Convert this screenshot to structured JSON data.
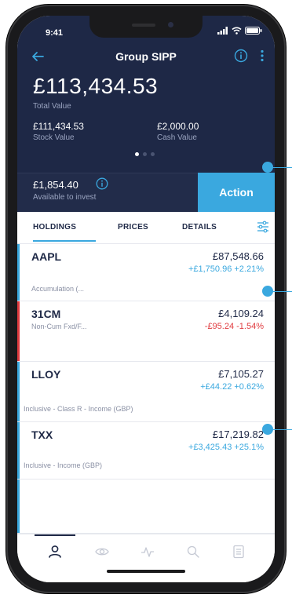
{
  "status_bar": {
    "time": "9:41"
  },
  "header": {
    "title": "Group SIPP"
  },
  "summary": {
    "total_value": "£113,434.53",
    "total_label": "Total Value",
    "stock_value": "£111,434.53",
    "stock_label": "Stock Value",
    "cash_value": "£2,000.00",
    "cash_label": "Cash Value"
  },
  "invest": {
    "amount": "£1,854.40",
    "label": "Available to invest",
    "action_label": "Action"
  },
  "tabs": [
    {
      "label": "HOLDINGS"
    },
    {
      "label": "PRICES"
    },
    {
      "label": "DETAILS"
    }
  ],
  "holdings": [
    {
      "ticker": "AAPL",
      "value": "£87,548.66",
      "change": "+£1,750.96 +2.21%",
      "desc": "Accumulation (...",
      "direction": "up",
      "bar_color": "#3aa8df"
    },
    {
      "ticker": "31CM",
      "value": "£4,109.24",
      "change": "-£95.24 -1.54%",
      "desc": "Non-Cum Fxd/F...",
      "direction": "down",
      "bar_color": "#e03a3e"
    },
    {
      "ticker": "LLOY",
      "value": "£7,105.27",
      "change": "+£44.22 +0.62%",
      "desc": "Inclusive - Class R - Income (GBP)",
      "direction": "up",
      "bar_color": "#3aa8df"
    },
    {
      "ticker": "TXX",
      "value": "£17,219.82",
      "change": "+£3,425.43 +25.1%",
      "desc": "Inclusive - Income (GBP)",
      "direction": "up",
      "bar_color": "#3aa8df"
    }
  ],
  "colors": {
    "navy": "#1e2846",
    "accent": "#3aa8df",
    "negative": "#e03a3e",
    "positive": "#3aa8df"
  },
  "tab_bar": [
    {
      "icon": "person-icon"
    },
    {
      "icon": "eye-icon"
    },
    {
      "icon": "pulse-icon"
    },
    {
      "icon": "search-icon"
    },
    {
      "icon": "document-icon"
    }
  ]
}
